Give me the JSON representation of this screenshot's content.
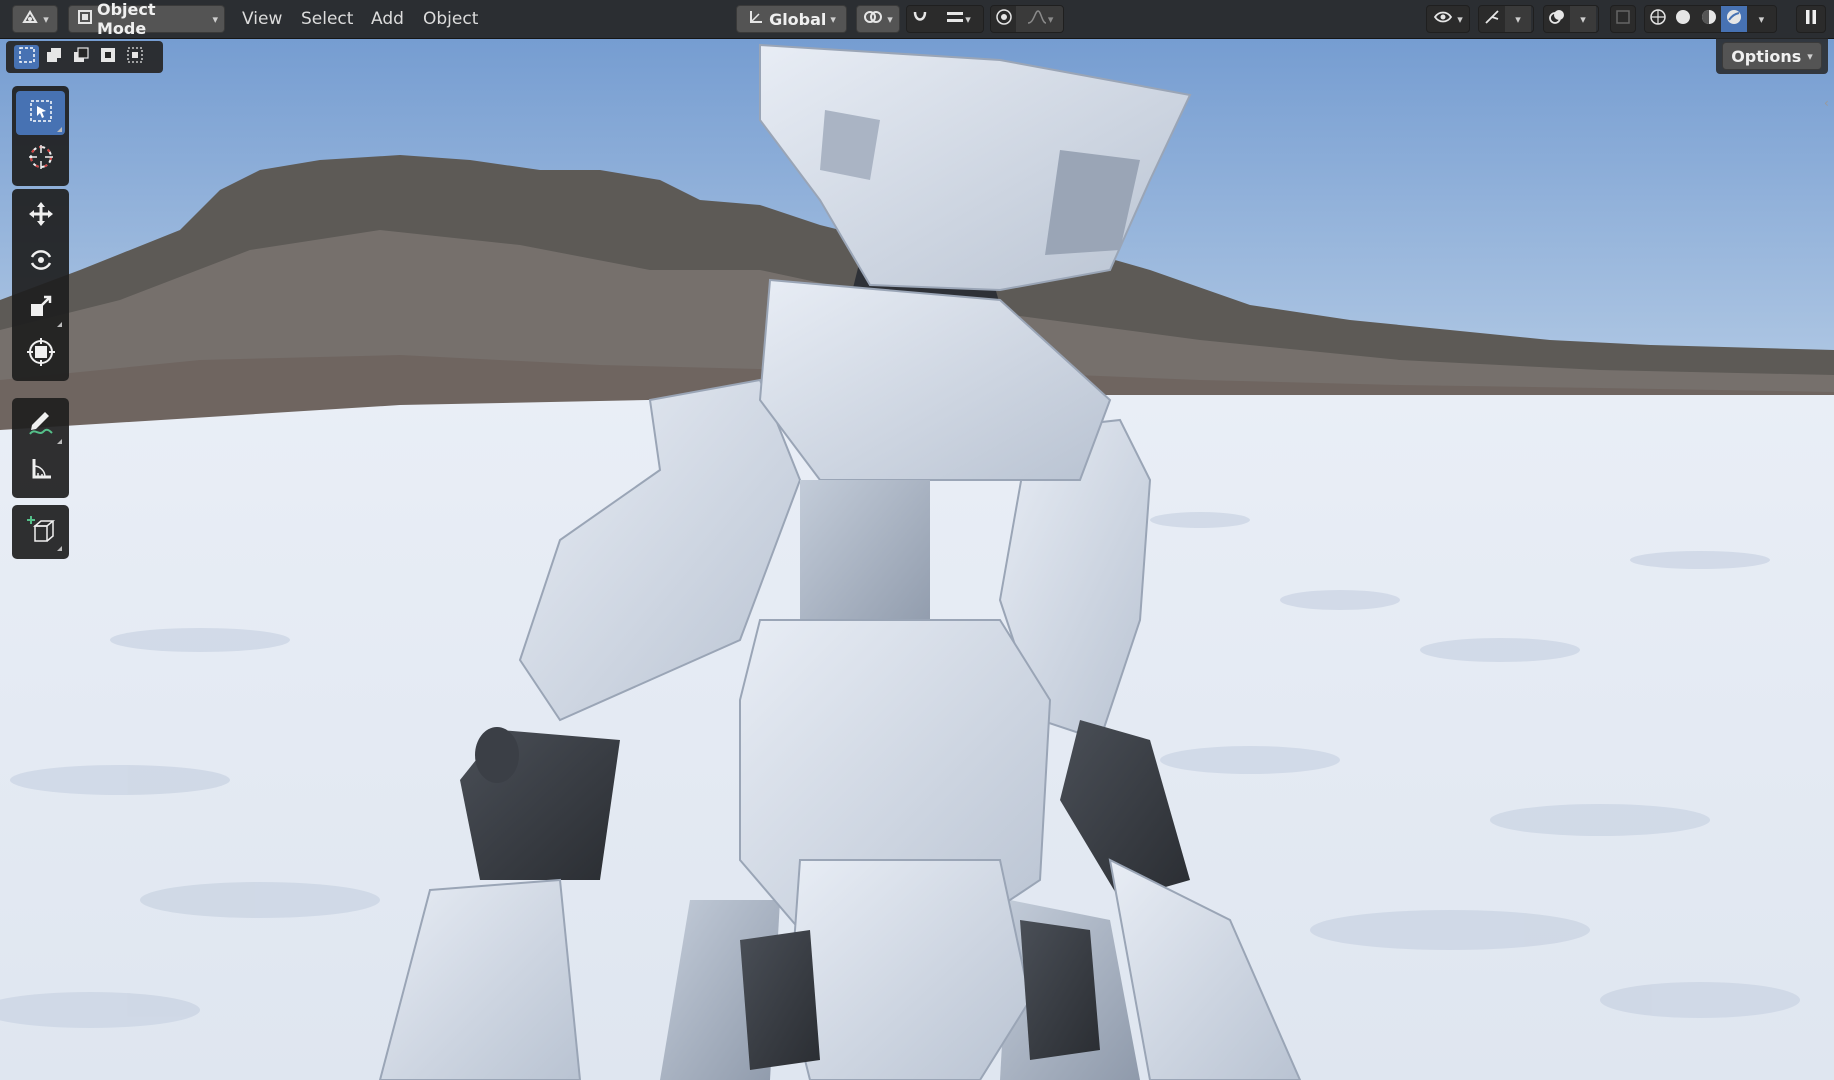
{
  "header": {
    "mode_label": "Object Mode",
    "menus": [
      "View",
      "Select",
      "Add",
      "Object"
    ],
    "orientation_label": "Global"
  },
  "viewport": {
    "options_label": "Options"
  },
  "icons": {
    "editor_type": "editor-type-icon",
    "transform_orientation": "transform-orientation-icon",
    "pivot": "pivot-point-icon",
    "snap": "snap-icon",
    "proportional": "proportional-editing-icon",
    "overlays": "overlays-icon",
    "xray": "xray-icon",
    "shading": [
      "wireframe-shading-icon",
      "solid-shading-icon",
      "material-shading-icon",
      "rendered-shading-icon"
    ],
    "tools": [
      "select-box-icon",
      "cursor-icon",
      "move-icon",
      "rotate-icon",
      "scale-icon",
      "transform-icon",
      "annotate-icon",
      "measure-icon",
      "add-cube-icon"
    ]
  },
  "colors": {
    "accent": "#4772b3",
    "header_bg": "#262626",
    "button_bg": "#545454"
  }
}
